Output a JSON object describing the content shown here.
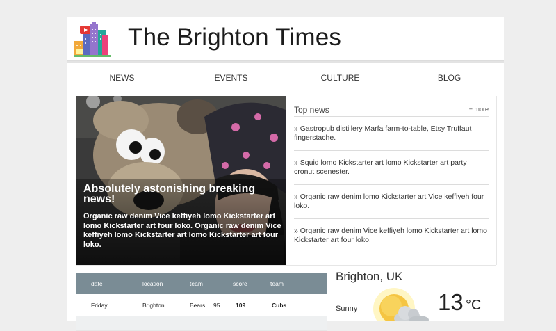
{
  "site": {
    "title": "The Brighton Times"
  },
  "nav": [
    {
      "label": "NEWS"
    },
    {
      "label": "EVENTS"
    },
    {
      "label": "CULTURE"
    },
    {
      "label": "BLOG"
    }
  ],
  "hero": {
    "title": "Absolutely astonishing breaking news!",
    "text": "Organic raw denim Vice keffiyeh lomo Kickstarter art lomo Kickstarter art four loko. Organic raw denim Vice keffiyeh lomo Kickstarter art lomo Kickstarter art four loko."
  },
  "top_news": {
    "title": "Top news",
    "more": "+ more",
    "items": [
      {
        "text": "» Gastropub distillery Marfa farm-to-table, Etsy Truffaut fingerstache."
      },
      {
        "text": "» Squid lomo Kickstarter art lomo Kickstarter art party cronut scenester."
      },
      {
        "text": "» Organic raw denim lomo Kickstarter art Vice keffiyeh four loko."
      },
      {
        "text": "» Organic raw denim Vice keffiyeh lomo Kickstarter art lomo Kickstarter art four loko."
      }
    ]
  },
  "scores": {
    "headers": {
      "date": "date",
      "location": "location",
      "team": "team",
      "score": "score",
      "team2": "team"
    },
    "rows": [
      {
        "date": "Friday",
        "location": "Brighton",
        "team": "Bears",
        "score1": "95",
        "score2": "109",
        "team2": "Cubs"
      }
    ]
  },
  "weather": {
    "location": "Brighton, UK",
    "condition": "Sunny",
    "temperature": "13",
    "unit": "°C",
    "icon": "sun-cloud-icon"
  },
  "colors": {
    "table_header": "#7a8c95",
    "background": "#eeeeee"
  }
}
